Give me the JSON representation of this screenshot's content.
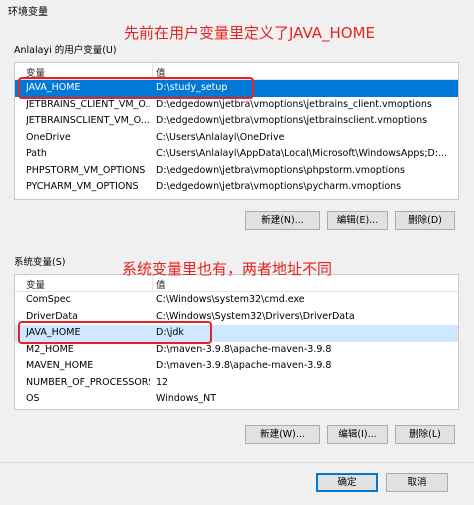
{
  "window": {
    "title": "环境变量"
  },
  "user_vars": {
    "group_label": "Anlalayi 的用户变量(U)",
    "col_name": "变量",
    "col_value": "值",
    "rows": [
      {
        "name": "JAVA_HOME",
        "value": "D:\\study_setup"
      },
      {
        "name": "JETBRAINS_CLIENT_VM_O...",
        "value": "D:\\edgedown\\jetbra\\vmoptions\\jetbrains_client.vmoptions"
      },
      {
        "name": "JETBRAINSCLIENT_VM_O...",
        "value": "D:\\edgedown\\jetbra\\vmoptions\\jetbrainsclient.vmoptions"
      },
      {
        "name": "OneDrive",
        "value": "C:\\Users\\Anlalayi\\OneDrive"
      },
      {
        "name": "Path",
        "value": "C:\\Users\\Anlalayi\\AppData\\Local\\Microsoft\\WindowsApps;D:..."
      },
      {
        "name": "PHPSTORM_VM_OPTIONS",
        "value": "D:\\edgedown\\jetbra\\vmoptions\\phpstorm.vmoptions"
      },
      {
        "name": "PYCHARM_VM_OPTIONS",
        "value": "D:\\edgedown\\jetbra\\vmoptions\\pycharm.vmoptions"
      }
    ],
    "buttons": {
      "new": "新建(N)...",
      "edit": "编辑(E)...",
      "delete": "删除(D)"
    }
  },
  "system_vars": {
    "group_label": "系统变量(S)",
    "col_name": "变量",
    "col_value": "值",
    "rows": [
      {
        "name": "ComSpec",
        "value": "C:\\Windows\\system32\\cmd.exe"
      },
      {
        "name": "DriverData",
        "value": "C:\\Windows\\System32\\Drivers\\DriverData"
      },
      {
        "name": "JAVA_HOME",
        "value": "D:\\jdk"
      },
      {
        "name": "M2_HOME",
        "value": "D:\\maven-3.9.8\\apache-maven-3.9.8"
      },
      {
        "name": "MAVEN_HOME",
        "value": "D:\\maven-3.9.8\\apache-maven-3.9.8"
      },
      {
        "name": "NUMBER_OF_PROCESSORS",
        "value": "12"
      },
      {
        "name": "OS",
        "value": "Windows_NT"
      }
    ],
    "buttons": {
      "new": "新建(W)...",
      "edit": "编辑(I)...",
      "delete": "删除(L)"
    }
  },
  "footer": {
    "ok": "确定",
    "cancel": "取消"
  },
  "annotations": {
    "top": "先前在用户变量里定义了JAVA_HOME",
    "bottom": "系统变量里也有，两者地址不同"
  },
  "colors": {
    "accent": "#0078d7",
    "annotation_red": "#e8231f"
  }
}
